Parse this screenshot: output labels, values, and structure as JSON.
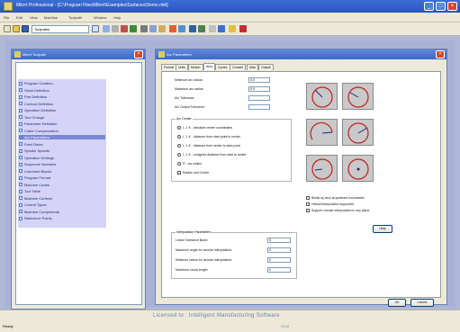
{
  "window": {
    "title": "Mikrrt Professional - [C:\\Program Files\\Mikrrt\\Examples\\Surfaces\\Demo.mkt]"
  },
  "menu": [
    "File",
    "Edit",
    "View",
    "Machine",
    "Toolpath",
    "Window",
    "Help"
  ],
  "toolbar": {
    "combo_value": "Toolpaths"
  },
  "tree_panel": {
    "title": "Mikrrt Toolpath",
    "items": [
      {
        "label": "Program Creation",
        "highlight": false
      },
      {
        "label": "Stock Definition",
        "highlight": false
      },
      {
        "label": "Part Definition",
        "highlight": false
      },
      {
        "label": "Contour Definition",
        "highlight": false
      },
      {
        "label": "Operation Definition",
        "highlight": false
      },
      {
        "label": "Tool Change",
        "highlight": false
      },
      {
        "label": "Parameter Definition",
        "highlight": false
      },
      {
        "label": "Cutter Compensation",
        "highlight": false
      },
      {
        "label": "Arc Parameters",
        "highlight": true
      },
      {
        "label": "Feed Rates",
        "highlight": false
      },
      {
        "label": "Spindle Speeds",
        "highlight": false
      },
      {
        "label": "Operation Settings",
        "highlight": false
      },
      {
        "label": "Sequence Numbers",
        "highlight": false
      },
      {
        "label": "Comment Blocks",
        "highlight": false
      },
      {
        "label": "Program Format",
        "highlight": false
      },
      {
        "label": "Machine Codes",
        "highlight": false
      },
      {
        "label": "Tool Table",
        "highlight": false
      },
      {
        "label": "Machine Controls",
        "highlight": false
      },
      {
        "label": "Control Types",
        "highlight": false
      },
      {
        "label": "Machine Components",
        "highlight": false
      },
      {
        "label": "Reference Points",
        "highlight": false
      }
    ]
  },
  "dialog": {
    "title": "Arc Parameters",
    "tabs": [
      "Format",
      "Units",
      "Motion",
      "Arcs",
      "Cycles",
      "Coolant",
      "Misc",
      "Output"
    ],
    "fields": [
      {
        "label": "Minimum arc radius:",
        "value": "0.0"
      },
      {
        "label": "Maximum arc radius:",
        "value": "0.0"
      },
      {
        "label": "Arc Tolerance:",
        "value": ""
      },
      {
        "label": "Arc Output Tolerance:",
        "value": ""
      }
    ],
    "arc_center_group": {
      "title": "Arc Center",
      "options": [
        "I, J, K - absolute center coordinates",
        "I, J, K - distance from start point to center",
        "I, J, K - distance from center to start point",
        "I, J, K - unsigned distance from start to center",
        "R - arc radius",
        "Radius and Center"
      ]
    },
    "interpolation_group": {
      "title": "Interpolation Parameters",
      "rows": [
        {
          "label": "Linear Tolerance Band:",
          "value": "0"
        },
        {
          "label": "Maximum angle for circular interpolation:",
          "value": "0"
        },
        {
          "label": "Minimum radius for circular interpolation:",
          "value": "0"
        },
        {
          "label": "Maximum chord length:",
          "value": "0"
        }
      ]
    },
    "options": [
      "Break up arcs at quadrant boundaries",
      "Helical interpolation supported",
      "Support circular interpolation in any plane"
    ],
    "help_label": "Help",
    "ok_label": "OK",
    "cancel_label": "Cancel"
  },
  "status": {
    "left": "Ready",
    "license": "Licensed to : Intelligent Manufacturing Software",
    "right": "NUM"
  }
}
